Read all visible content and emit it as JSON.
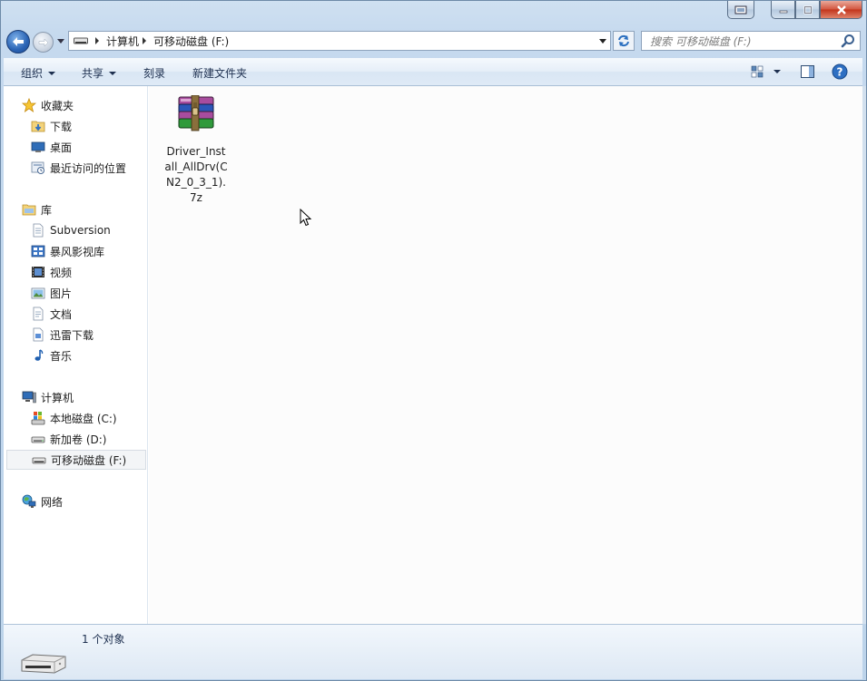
{
  "navbar": {
    "breadcrumb": [
      "计算机",
      "可移动磁盘 (F:)"
    ],
    "search_placeholder": "搜索 可移动磁盘 (F:)"
  },
  "toolbar": {
    "organize": "组织",
    "share": "共享",
    "burn": "刻录",
    "new_folder": "新建文件夹"
  },
  "sidebar": {
    "favorites": {
      "label": "收藏夹",
      "items": [
        "下载",
        "桌面",
        "最近访问的位置"
      ]
    },
    "libraries": {
      "label": "库",
      "items": [
        "Subversion",
        "暴风影视库",
        "视频",
        "图片",
        "文档",
        "迅雷下载",
        "音乐"
      ]
    },
    "computer": {
      "label": "计算机",
      "items": [
        "本地磁盘 (C:)",
        "新加卷 (D:)",
        "可移动磁盘 (F:)"
      ],
      "selected": "可移动磁盘 (F:)"
    },
    "network": {
      "label": "网络"
    }
  },
  "files": [
    {
      "name": "Driver_Install_AllDrv(CN2_0_3_1).7z",
      "icon": "winrar-archive-icon"
    }
  ],
  "status": {
    "count": "1 个对象"
  },
  "colors": {
    "accent": "#2a63b4",
    "close": "#c2331a",
    "selection": "#f3f5f7"
  }
}
